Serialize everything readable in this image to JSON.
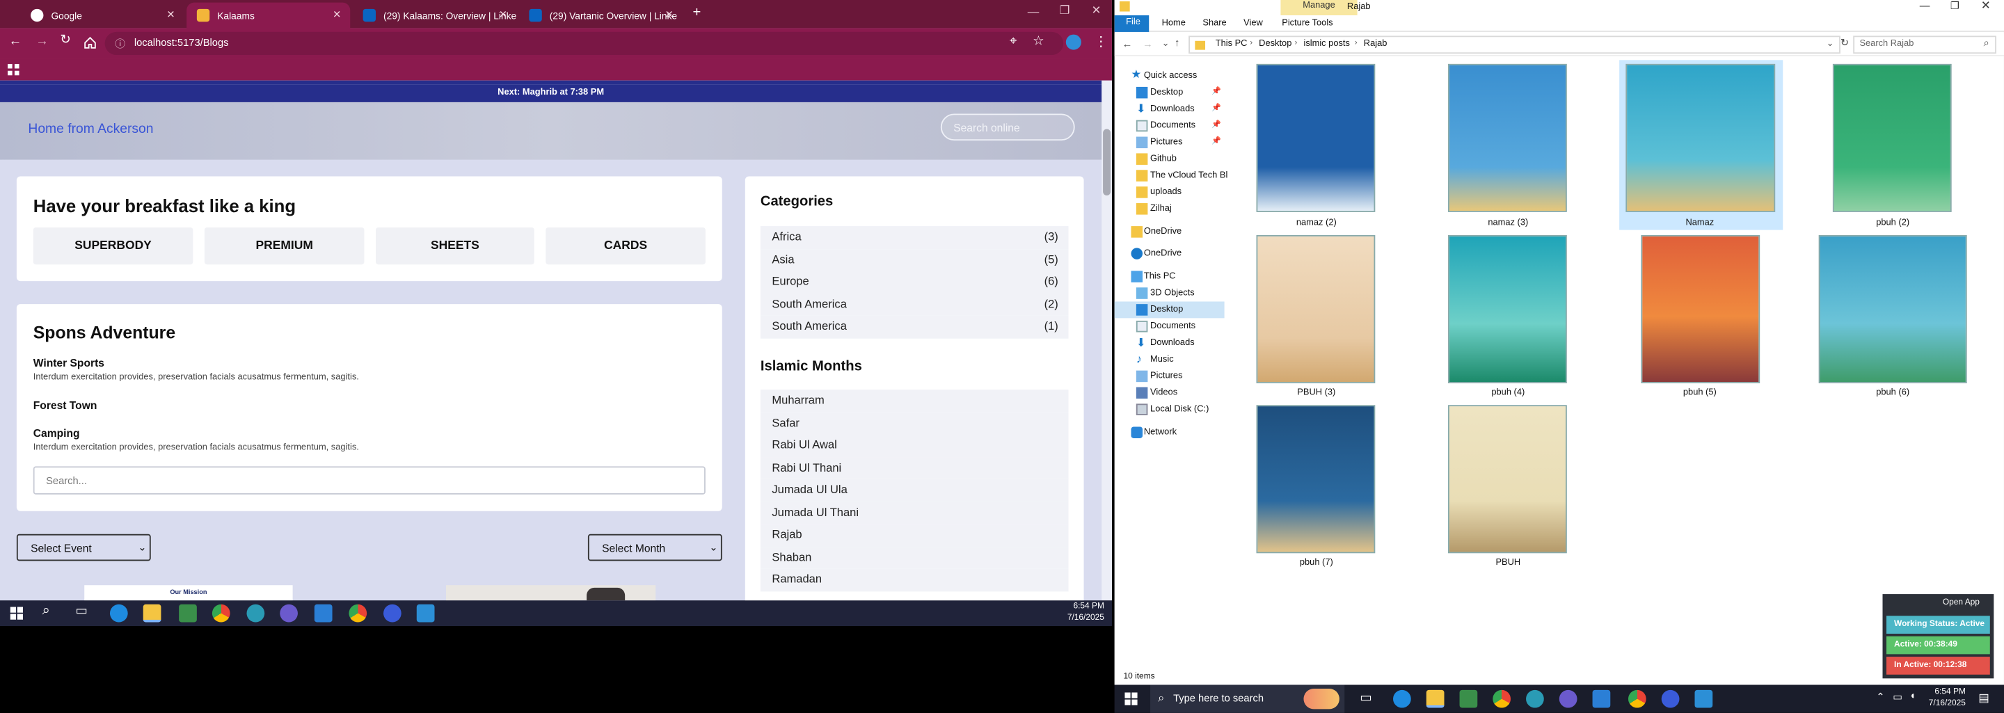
{
  "browser": {
    "tabs": [
      {
        "label": "Google",
        "color": "#ffffff"
      },
      {
        "label": "Kalaams",
        "color": "#f3b53a"
      },
      {
        "label": "(29) Kalaams: Overview | Linke",
        "color": "#0a66c2"
      },
      {
        "label": "(29) Vartanic Overview | Linke",
        "color": "#0a66c2"
      }
    ],
    "url": "localhost:5173/Blogs",
    "new_tab": "+"
  },
  "site": {
    "prayer_bar": "Next: Maghrib at 7:38 PM",
    "home_link": "Home from Ackerson",
    "search_placeholder": "Search online",
    "breakfast_title": "Have your breakfast like a king",
    "buttons": [
      "SUPERBODY",
      "PREMIUM",
      "SHEETS",
      "CARDS"
    ],
    "adventure_title": "Spons Adventure",
    "adventures": [
      {
        "title": "Winter Sports",
        "desc": "Interdum exercitation provides, preservation facials acusatmus fermentum, sagitis."
      },
      {
        "title": "Forest Town",
        "desc": ""
      },
      {
        "title": "Camping",
        "desc": "Interdum exercitation provides, preservation facials acusatmus fermentum, sagitis."
      }
    ],
    "adventure_search_placeholder": "Search...",
    "select_event": "Select Event",
    "select_month": "Select Month",
    "mission_label": "Our Mission",
    "categories_title": "Categories",
    "categories": [
      {
        "name": "Africa",
        "count": "(3)"
      },
      {
        "name": "Asia",
        "count": "(5)"
      },
      {
        "name": "Europe",
        "count": "(6)"
      },
      {
        "name": "South America",
        "count": "(2)"
      },
      {
        "name": "South America",
        "count": "(1)"
      }
    ],
    "months_title": "Islamic Months",
    "months": [
      "Muharram",
      "Safar",
      "Rabi Ul Awal",
      "Rabi Ul Thani",
      "Jumada Ul Ula",
      "Jumada Ul Thani",
      "Rajab",
      "Shaban",
      "Ramadan"
    ]
  },
  "left_taskbar": {
    "time": "6:54 PM",
    "date": "7/16/2025"
  },
  "explorer": {
    "title": "Rajab",
    "manage_tab": "Manage",
    "ribbon_tabs": [
      "File",
      "Home",
      "Share",
      "View",
      "Picture Tools"
    ],
    "breadcrumb": [
      "This PC",
      "Desktop",
      "islmic posts",
      "Rajab"
    ],
    "search_placeholder": "Search Rajab",
    "nav": [
      {
        "label": "Quick access",
        "icon": "star-icon"
      },
      {
        "label": "Desktop",
        "icon": "desktop-icon"
      },
      {
        "label": "Downloads",
        "icon": "download-icon"
      },
      {
        "label": "Documents",
        "icon": "document-icon"
      },
      {
        "label": "Pictures",
        "icon": "pictures-icon"
      },
      {
        "label": "Github",
        "icon": "folder-icon"
      },
      {
        "label": "The vCloud Tech Bl",
        "icon": "folder-icon"
      },
      {
        "label": "uploads",
        "icon": "folder-icon"
      },
      {
        "label": "Zilhaj",
        "icon": "folder-icon"
      },
      {
        "label": "OneDrive",
        "icon": "folder-icon"
      },
      {
        "label": "OneDrive",
        "icon": "cloud-icon"
      },
      {
        "label": "This PC",
        "icon": "computer-icon"
      },
      {
        "label": "3D Objects",
        "icon": "cube-icon"
      },
      {
        "label": "Desktop",
        "icon": "desktop-icon"
      },
      {
        "label": "Documents",
        "icon": "document-icon"
      },
      {
        "label": "Downloads",
        "icon": "download-icon"
      },
      {
        "label": "Music",
        "icon": "music-icon"
      },
      {
        "label": "Pictures",
        "icon": "pictures-icon"
      },
      {
        "label": "Videos",
        "icon": "video-icon"
      },
      {
        "label": "Local Disk (C:)",
        "icon": "disk-icon"
      },
      {
        "label": "Network",
        "icon": "network-icon"
      }
    ],
    "files": [
      {
        "name": "namaz (2)",
        "bg": "#1f5fa8"
      },
      {
        "name": "namaz (3)",
        "bg": "#3a8fd0"
      },
      {
        "name": "Namaz",
        "bg": "#2fa5c9"
      },
      {
        "name": "pbuh (2)",
        "bg": "#2aa06a"
      },
      {
        "name": "PBUH (3)",
        "bg": "#e7c9a3"
      },
      {
        "name": "pbuh (4)",
        "bg": "#1fa4b8"
      },
      {
        "name": "pbuh (5)",
        "bg": "#e0603a"
      },
      {
        "name": "pbuh (6)",
        "bg": "#3aa0c8"
      },
      {
        "name": "pbuh (7)",
        "bg": "#1e4f7e"
      },
      {
        "name": "PBUH",
        "bg": "#e9ddb5"
      }
    ],
    "item_count": "10 items",
    "widget": {
      "open_app": "Open App",
      "working": "Working Status: Active",
      "active": "Active: 00:38:49",
      "inactive": "In Active: 00:12:38"
    }
  },
  "right_taskbar": {
    "search_placeholder": "Type here to search",
    "time": "6:54 PM",
    "date": "7/16/2025"
  }
}
